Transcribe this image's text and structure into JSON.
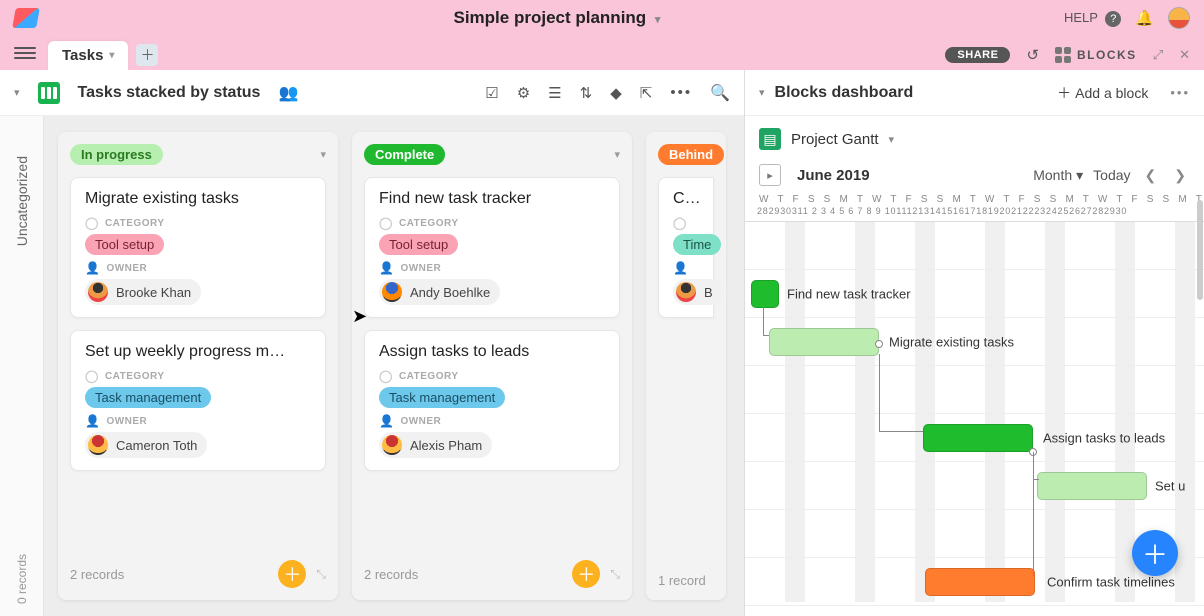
{
  "app": {
    "title": "Simple project planning",
    "help": "HELP"
  },
  "tabs": {
    "main": "Tasks"
  },
  "tabbar": {
    "share": "SHARE",
    "blocks": "BLOCKS"
  },
  "view": {
    "name": "Tasks stacked by status"
  },
  "sidecol": {
    "label": "Uncategorized",
    "count": "0 records"
  },
  "field_labels": {
    "category": "CATEGORY",
    "owner": "OWNER"
  },
  "categories": {
    "tool": "Tool setup",
    "taskm": "Task management",
    "time": "Time"
  },
  "columns": [
    {
      "status": "In progress",
      "pill": "pill-progress",
      "record_label": "2 records",
      "cards": [
        {
          "title": "Migrate existing tasks",
          "catKey": "tool",
          "owner": "Brooke Khan",
          "avClass": ""
        },
        {
          "title": "Set up weekly progress m…",
          "catKey": "taskm",
          "owner": "Cameron Toth",
          "avClass": "c3"
        }
      ]
    },
    {
      "status": "Complete",
      "pill": "pill-complete",
      "record_label": "2 records",
      "cards": [
        {
          "title": "Find new task tracker",
          "catKey": "tool",
          "owner": "Andy Boehlke",
          "avClass": "c2"
        },
        {
          "title": "Assign tasks to leads",
          "catKey": "taskm",
          "owner": "Alexis Pham",
          "avClass": "c3"
        }
      ]
    },
    {
      "status": "Behind",
      "pill": "pill-behind",
      "record_label": "1 record",
      "cards": [
        {
          "title": "Conf",
          "catKey": "time",
          "owner": "B",
          "avClass": ""
        }
      ]
    }
  ],
  "blocks": {
    "dashboard": "Blocks dashboard",
    "add": "Add a block",
    "block_name": "Project Gantt",
    "month": "June 2019",
    "mode": "Month",
    "today": "Today",
    "days": "W T F S S M T W T F S S M T W T F S S M T W T F S S M T W T F S",
    "nums": "282930311 2 3 4 5 6 7 8 9 101112131415161718192021222324252627282930",
    "bars": [
      {
        "label": "Find new task tracker"
      },
      {
        "label": "Migrate existing tasks"
      },
      {
        "label": "Assign tasks to leads"
      },
      {
        "label": "Set u"
      },
      {
        "label": "Confirm task timelines"
      }
    ]
  }
}
